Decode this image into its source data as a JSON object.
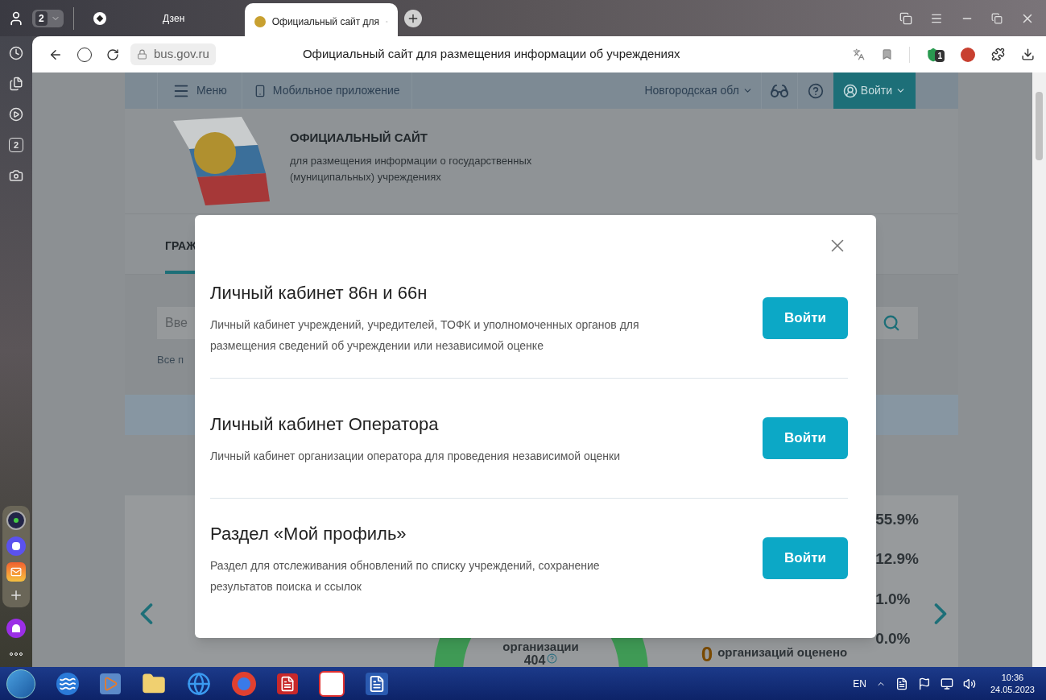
{
  "browser": {
    "tab_counter": "2",
    "tabs": [
      {
        "label": "Дзен",
        "selected": false
      },
      {
        "label": "Официальный сайт для",
        "selected": true
      }
    ],
    "address": "bus.gov.ru",
    "page_title": "Официальный сайт для размещения информации об учреждениях",
    "shield_badge": "1"
  },
  "browser_sidebar": {
    "tab_counter": "2"
  },
  "site": {
    "topbar": {
      "menu": "Меню",
      "mobile_app": "Мобильное приложение",
      "region": "Новгородская обл",
      "login": "Войти"
    },
    "header": {
      "title": "ОФИЦИАЛЬНЫЙ САЙТ",
      "subtitle": "для размещения информации о государственных (муниципальных) учреждениях"
    },
    "tabs": [
      {
        "label": "ГРАЖ",
        "selected": true
      }
    ],
    "search": {
      "placeholder": "Вве",
      "hint": "Все п"
    },
    "stats": {
      "donut_label": "организации",
      "donut_value": "404",
      "rated_count": "0",
      "rated_label": "организаций оценено",
      "percentages": [
        "55.9%",
        "12.9%",
        "1.0%",
        "0.0%"
      ]
    }
  },
  "modal": {
    "sections": [
      {
        "title": "Личный кабинет 86н и 66н",
        "description": "Личный кабинет учреждений, учредителей, ТОФК и уполномоченных органов для размещения сведений об учреждении или независимой оценке",
        "button": "Войти"
      },
      {
        "title": "Личный кабинет Оператора",
        "description": "Личный кабинет организации оператора для проведения независимой оценки",
        "button": "Войти"
      },
      {
        "title": "Раздел «Мой профиль»",
        "description": "Раздел для отслеживания обновлений по списку учреждений, сохранение результатов поиска и ссылок",
        "button": "Войти"
      }
    ]
  },
  "taskbar": {
    "language": "EN",
    "time": "10:36",
    "date": "24.05.2023"
  }
}
